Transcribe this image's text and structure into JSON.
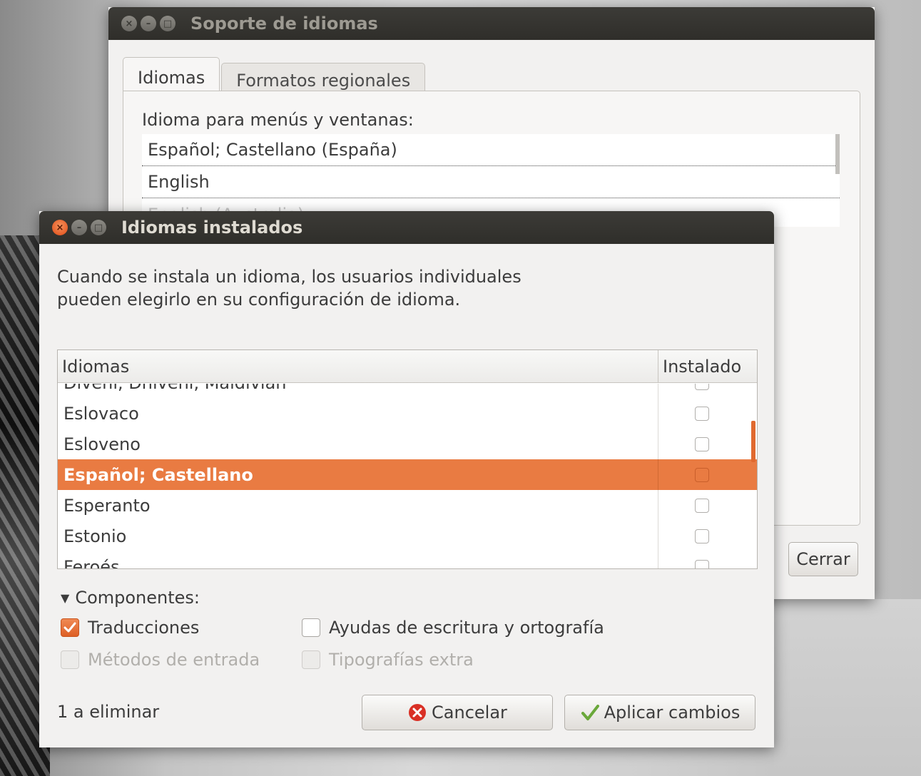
{
  "back_window": {
    "title": "Soporte de idiomas",
    "tabs": [
      {
        "label": "Idiomas",
        "active": true
      },
      {
        "label": "Formatos regionales",
        "active": false
      }
    ],
    "menu_language_label": "Idioma para menús y ventanas:",
    "languages": [
      "Español; Castellano (España)",
      "English",
      "English (Australia)"
    ],
    "close_label": "Cerrar"
  },
  "front_window": {
    "title": "Idiomas instalados",
    "description": "Cuando se instala un idioma, los usuarios individuales pueden elegirlo en su configuración de idioma.",
    "table": {
      "headers": [
        "Idiomas",
        "Instalado"
      ],
      "rows": [
        {
          "name": "Divehi, Dhivehi, Maldivian",
          "installed": false
        },
        {
          "name": "Eslovaco",
          "installed": false
        },
        {
          "name": "Esloveno",
          "installed": false
        },
        {
          "name": "Español; Castellano",
          "installed": false,
          "selected": true
        },
        {
          "name": "Esperanto",
          "installed": false
        },
        {
          "name": "Estonio",
          "installed": false
        },
        {
          "name": "Feroés",
          "installed": false
        }
      ]
    },
    "components": {
      "label": "Componentes:",
      "options": {
        "translations": {
          "label": "Traducciones",
          "checked": true,
          "enabled": true
        },
        "writing_aids": {
          "label": "Ayudas de escritura y ortografía",
          "checked": false,
          "enabled": true
        },
        "input_methods": {
          "label": "Métodos de entrada",
          "checked": false,
          "enabled": false
        },
        "extra_fonts": {
          "label": "Tipografías extra",
          "checked": false,
          "enabled": false
        }
      }
    },
    "status": "1 a eliminar",
    "cancel_label": "Cancelar",
    "apply_label": "Aplicar cambios"
  },
  "colors": {
    "accent": "#e97b42",
    "titlebar": "#3c3b37",
    "window_bg": "#f2f1f0"
  },
  "icons": [
    "close-icon",
    "minimize-icon",
    "maximize-icon",
    "cancel-icon",
    "checkmark-icon",
    "disclosure-triangle-icon"
  ]
}
